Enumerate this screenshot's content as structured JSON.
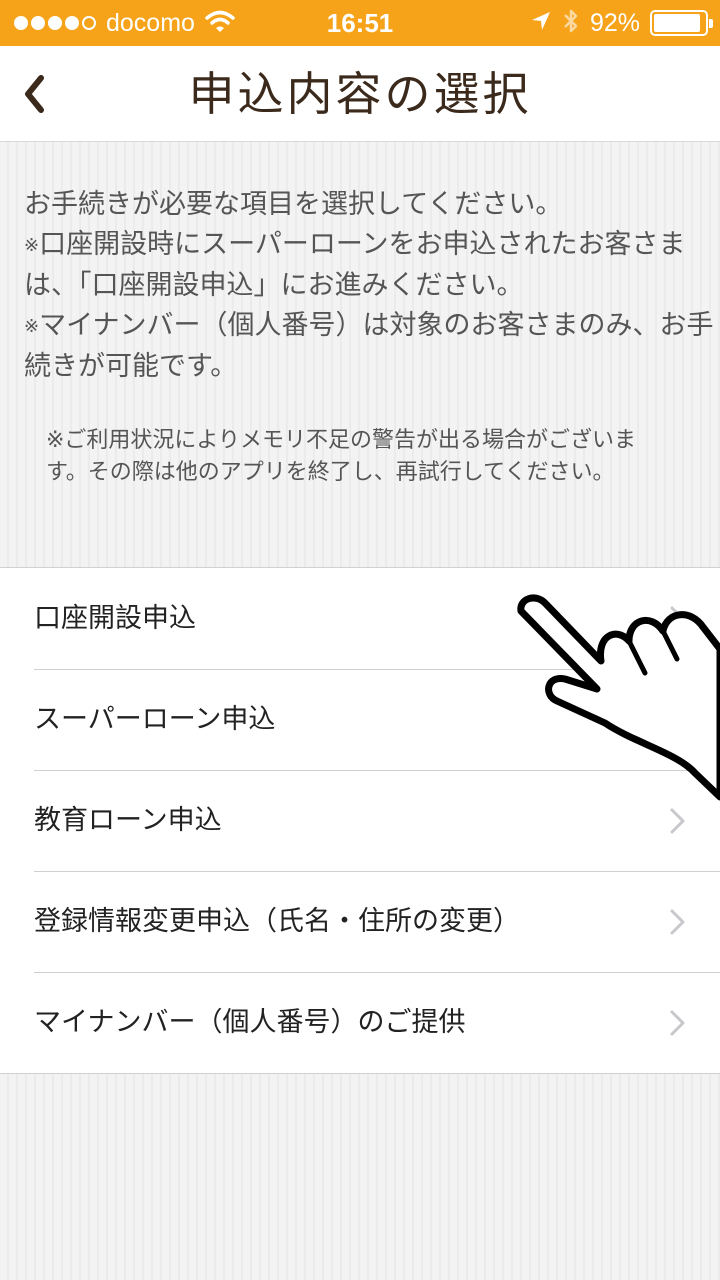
{
  "status_bar": {
    "carrier": "docomo",
    "time": "16:51",
    "battery_percent_text": "92%",
    "battery_level": 0.92,
    "signal_dots_filled": 4,
    "signal_dots_total": 5,
    "icons": [
      "signal-dots-icon",
      "wifi-icon",
      "location-arrow-icon",
      "bluetooth-icon",
      "battery-icon"
    ]
  },
  "nav": {
    "back_icon": "back-chevron-icon",
    "title": "申込内容の選択"
  },
  "intro": {
    "line1": "お手続きが必要な項目を選択してください。",
    "note1_mark": "※",
    "note1": "口座開設時にスーパーローンをお申込されたお客さまは、「口座開設申込」にお進みください。",
    "note2_mark": "※",
    "note2": "マイナンバー（個人番号）は対象のお客さまのみ、お手続きが可能です。"
  },
  "memory_note": "※ご利用状況によりメモリ不足の警告が出る場合がございます。その際は他のアプリを終了し、再試行してください。",
  "menu": {
    "items": [
      {
        "label": "口座開設申込",
        "icon": "chevron-right-icon"
      },
      {
        "label": "スーパーローン申込",
        "icon": "chevron-right-icon"
      },
      {
        "label": "教育ローン申込",
        "icon": "chevron-right-icon"
      },
      {
        "label": "登録情報変更申込（氏名・住所の変更）",
        "icon": "chevron-right-icon"
      },
      {
        "label": "マイナンバー（個人番号）のご提供",
        "icon": "chevron-right-icon"
      }
    ]
  },
  "overlay": {
    "icon": "pointing-hand-icon"
  },
  "colors": {
    "status_bar": "#f6a319",
    "title_text": "#3b2a1c",
    "chevron": "#c7c7cc"
  }
}
